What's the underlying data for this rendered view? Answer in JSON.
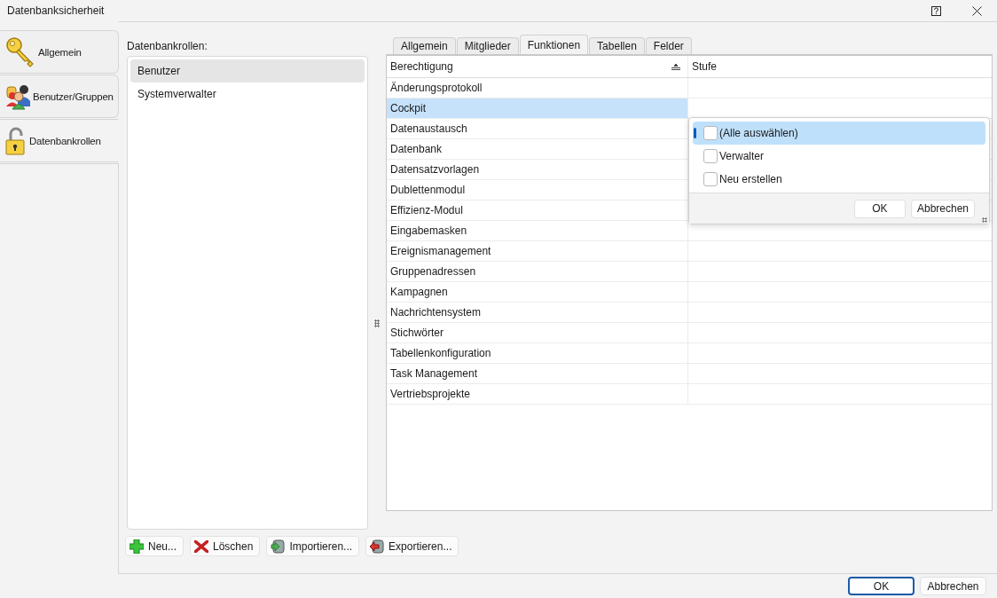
{
  "window": {
    "title": "Datenbanksicherheit"
  },
  "nav": {
    "items": [
      {
        "label": "Allgemein",
        "kind": "key",
        "selected": false
      },
      {
        "label": "Benutzer/Gruppen",
        "kind": "users",
        "selected": false
      },
      {
        "label": "Datenbankrollen",
        "kind": "lock",
        "selected": true
      }
    ]
  },
  "roles": {
    "label": "Datenbankrollen:",
    "items": [
      {
        "label": "Benutzer",
        "selected": true
      },
      {
        "label": "Systemverwalter",
        "selected": false
      }
    ],
    "buttons": [
      {
        "label": "Neu...",
        "kind": "add"
      },
      {
        "label": "Löschen",
        "kind": "delete"
      },
      {
        "label": "Importieren...",
        "kind": "import"
      },
      {
        "label": "Exportieren...",
        "kind": "export"
      }
    ]
  },
  "tabs": [
    {
      "label": "Allgemein",
      "selected": false
    },
    {
      "label": "Mitglieder",
      "selected": false
    },
    {
      "label": "Funktionen",
      "selected": true
    },
    {
      "label": "Tabellen",
      "selected": false
    },
    {
      "label": "Felder",
      "selected": false
    }
  ],
  "table": {
    "columns": [
      "Berechtigung",
      "Stufe"
    ],
    "rows": [
      {
        "name": "Änderungsprotokoll",
        "selected": false
      },
      {
        "name": "Cockpit",
        "selected": true
      },
      {
        "name": "Datenaustausch",
        "selected": false
      },
      {
        "name": "Datenbank",
        "selected": false
      },
      {
        "name": "Datensatzvorlagen",
        "selected": false
      },
      {
        "name": "Dublettenmodul",
        "selected": false
      },
      {
        "name": "Effizienz-Modul",
        "selected": false
      },
      {
        "name": "Eingabemasken",
        "selected": false
      },
      {
        "name": "Ereignismanagement",
        "selected": false
      },
      {
        "name": "Gruppenadressen",
        "selected": false
      },
      {
        "name": "Kampagnen",
        "selected": false
      },
      {
        "name": "Nachrichtensystem",
        "selected": false
      },
      {
        "name": "Stichwörter",
        "selected": false
      },
      {
        "name": "Tabellenkonfiguration",
        "selected": false
      },
      {
        "name": "Task Management",
        "selected": false
      },
      {
        "name": "Vertriebsprojekte",
        "selected": false
      }
    ]
  },
  "filter_popup": {
    "items": [
      {
        "label": "(Alle auswählen)",
        "checked": false,
        "selected": true
      },
      {
        "label": "Verwalter",
        "checked": false,
        "selected": false
      },
      {
        "label": "Neu erstellen",
        "checked": false,
        "selected": false
      }
    ],
    "buttons": [
      "OK",
      "Abbrechen"
    ]
  },
  "footer": {
    "buttons": [
      {
        "label": "OK",
        "focused": true
      },
      {
        "label": "Abbrechen",
        "focused": false
      }
    ]
  }
}
